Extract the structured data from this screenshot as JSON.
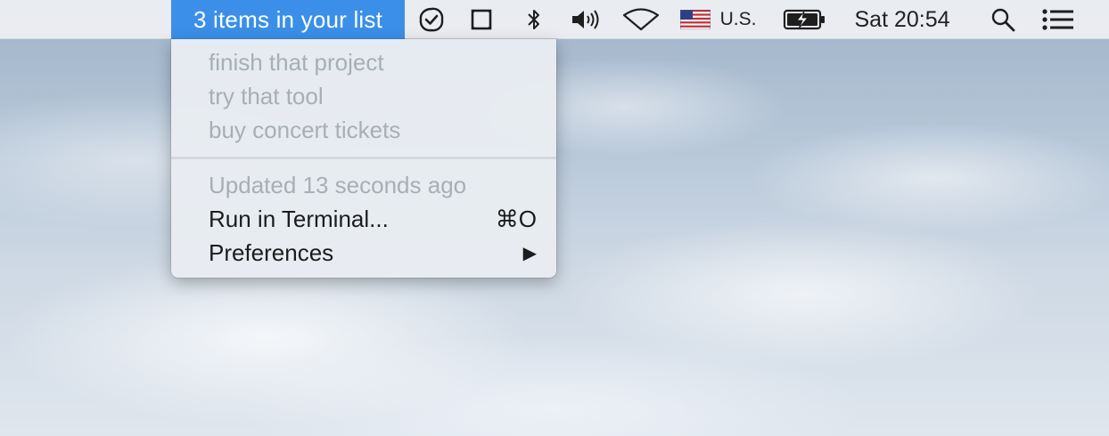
{
  "menubar": {
    "app_title": "3 items in your list",
    "input_source": "U.S.",
    "clock": "Sat 20:54",
    "icons": [
      "checklist-app-icon",
      "window-square-icon",
      "bluetooth-icon",
      "volume-icon",
      "wifi-icon",
      "us-flag-icon",
      "battery-charging-icon",
      "spotlight-search-icon",
      "notification-center-icon"
    ]
  },
  "dropdown": {
    "items": [
      {
        "label": "finish that project"
      },
      {
        "label": "try that tool"
      },
      {
        "label": "buy concert tickets"
      }
    ],
    "updated": "Updated 13 seconds ago",
    "run_terminal": {
      "label": "Run in Terminal...",
      "shortcut": "⌘O"
    },
    "preferences": {
      "label": "Preferences",
      "arrow": "▶"
    }
  },
  "colors": {
    "highlight": "#3b8fe8",
    "disabled_text": "#a8aeb6",
    "menu_bg": "#e8ecf2"
  }
}
